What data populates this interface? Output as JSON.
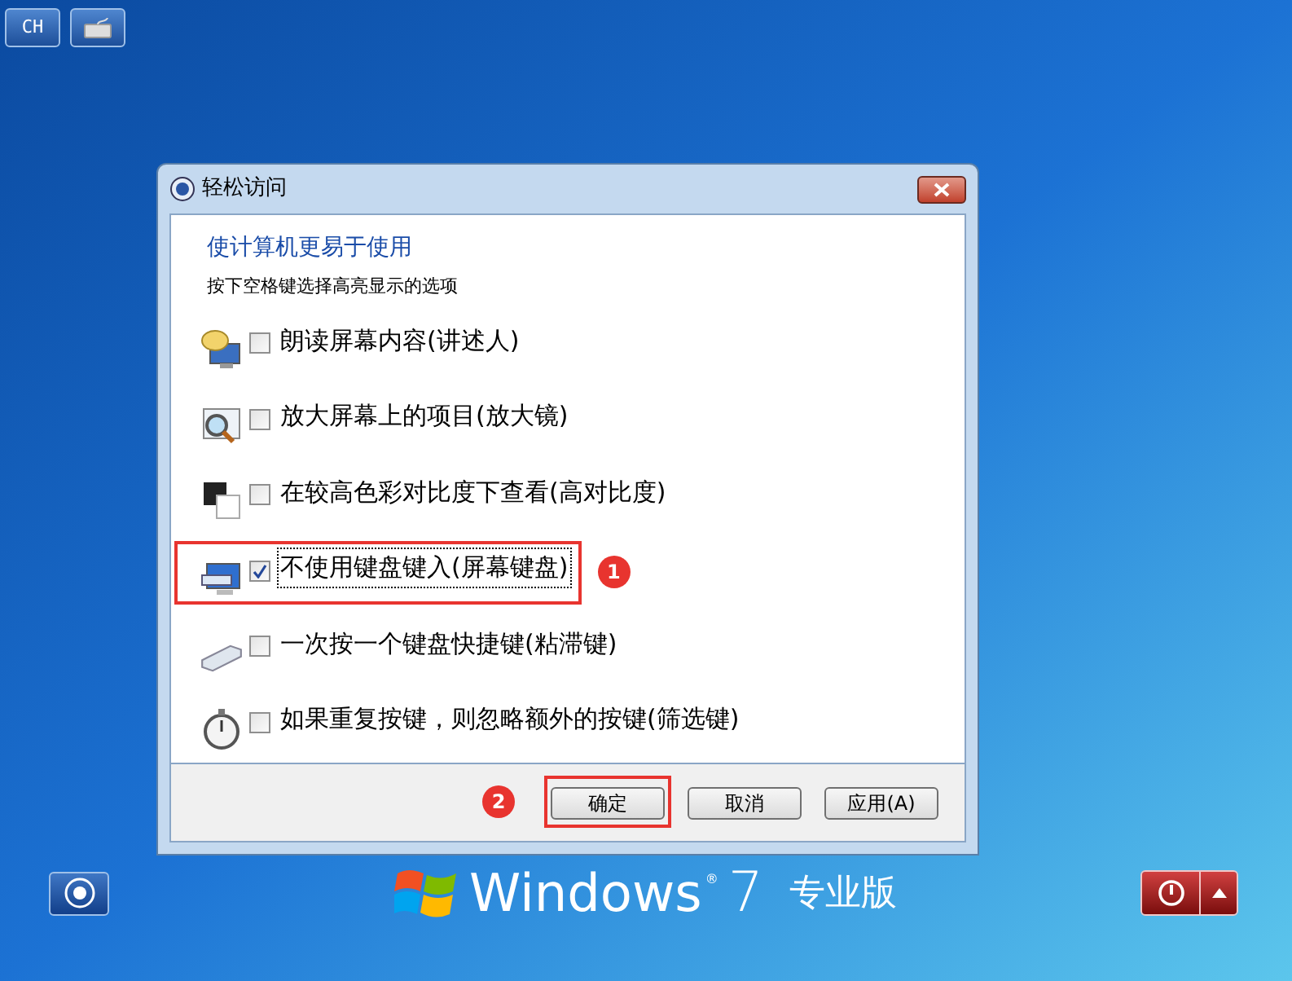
{
  "top_buttons": {
    "language": "CH"
  },
  "dialog": {
    "title": "轻松访问",
    "heading": "使计算机更易于使用",
    "instruction": "按下空格键选择高亮显示的选项",
    "options": [
      {
        "label": "朗读屏幕内容(讲述人)",
        "checked": false,
        "focused": false,
        "highlighted": false
      },
      {
        "label": "放大屏幕上的项目(放大镜)",
        "checked": false,
        "focused": false,
        "highlighted": false
      },
      {
        "label": "在较高色彩对比度下查看(高对比度)",
        "checked": false,
        "focused": false,
        "highlighted": false
      },
      {
        "label": "不使用键盘键入(屏幕键盘)",
        "checked": true,
        "focused": true,
        "highlighted": true,
        "badge": "1"
      },
      {
        "label": "一次按一个键盘快捷键(粘滞键)",
        "checked": false,
        "focused": false,
        "highlighted": false
      },
      {
        "label": "如果重复按键，则忽略额外的按键(筛选键)",
        "checked": false,
        "focused": false,
        "highlighted": false
      }
    ],
    "buttons": [
      {
        "label": "确定",
        "highlighted": true,
        "badge": "2"
      },
      {
        "label": "取消",
        "highlighted": false
      },
      {
        "label": "应用(A)",
        "highlighted": false
      }
    ]
  },
  "branding": {
    "name": "Windows",
    "mark": "®",
    "version": "7",
    "edition": "专业版"
  }
}
